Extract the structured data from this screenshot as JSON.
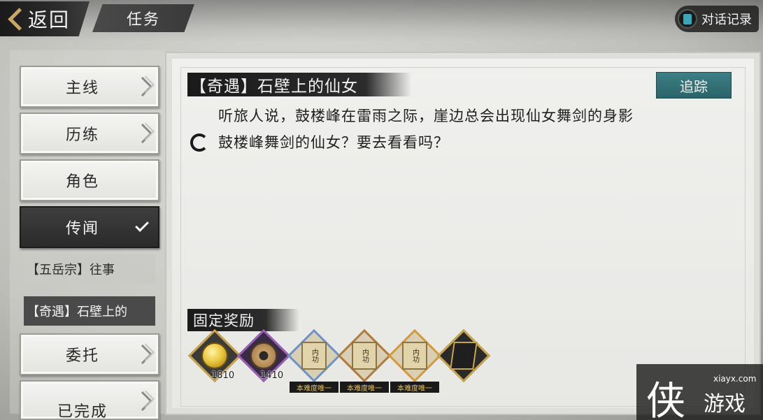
{
  "header": {
    "back_label": "返回",
    "title": "任务",
    "dialog_record_label": "对话记录"
  },
  "menu": {
    "items": [
      {
        "label": "主线"
      },
      {
        "label": "历练"
      },
      {
        "label": "角色"
      },
      {
        "label": "传闻"
      },
      {
        "label": "委托"
      },
      {
        "label": "已完成"
      }
    ],
    "sub_items": [
      {
        "label": "【五岳宗】往事"
      },
      {
        "label": "【奇遇】石壁上的"
      }
    ]
  },
  "quest": {
    "title": "【奇遇】石壁上的仙女",
    "track_label": "追踪",
    "description": "听旅人说，鼓楼峰在雷雨之际，崖边总会出现仙女舞剑的身影",
    "objective": "鼓楼峰舞剑的仙女？要去看看吗？"
  },
  "rewards": {
    "title": "固定奖励",
    "items": [
      {
        "icon": "gold-coin-icon",
        "count": "1810",
        "tag": ""
      },
      {
        "icon": "copper-coin-icon",
        "count": "1410",
        "tag": ""
      },
      {
        "icon": "martial-scroll-icon",
        "count": "",
        "scroll_text": "内功",
        "tag": "本难度唯一"
      },
      {
        "icon": "martial-scroll-icon",
        "count": "",
        "scroll_text": "内功",
        "tag": "本难度唯一"
      },
      {
        "icon": "martial-scroll-icon",
        "count": "",
        "scroll_text": "内功",
        "tag": "本难度唯一"
      },
      {
        "icon": "book-icon",
        "count": "",
        "tag": ""
      }
    ]
  },
  "watermark": {
    "logo_char": "侠",
    "url": "xiayx.com",
    "text": "游戏"
  }
}
